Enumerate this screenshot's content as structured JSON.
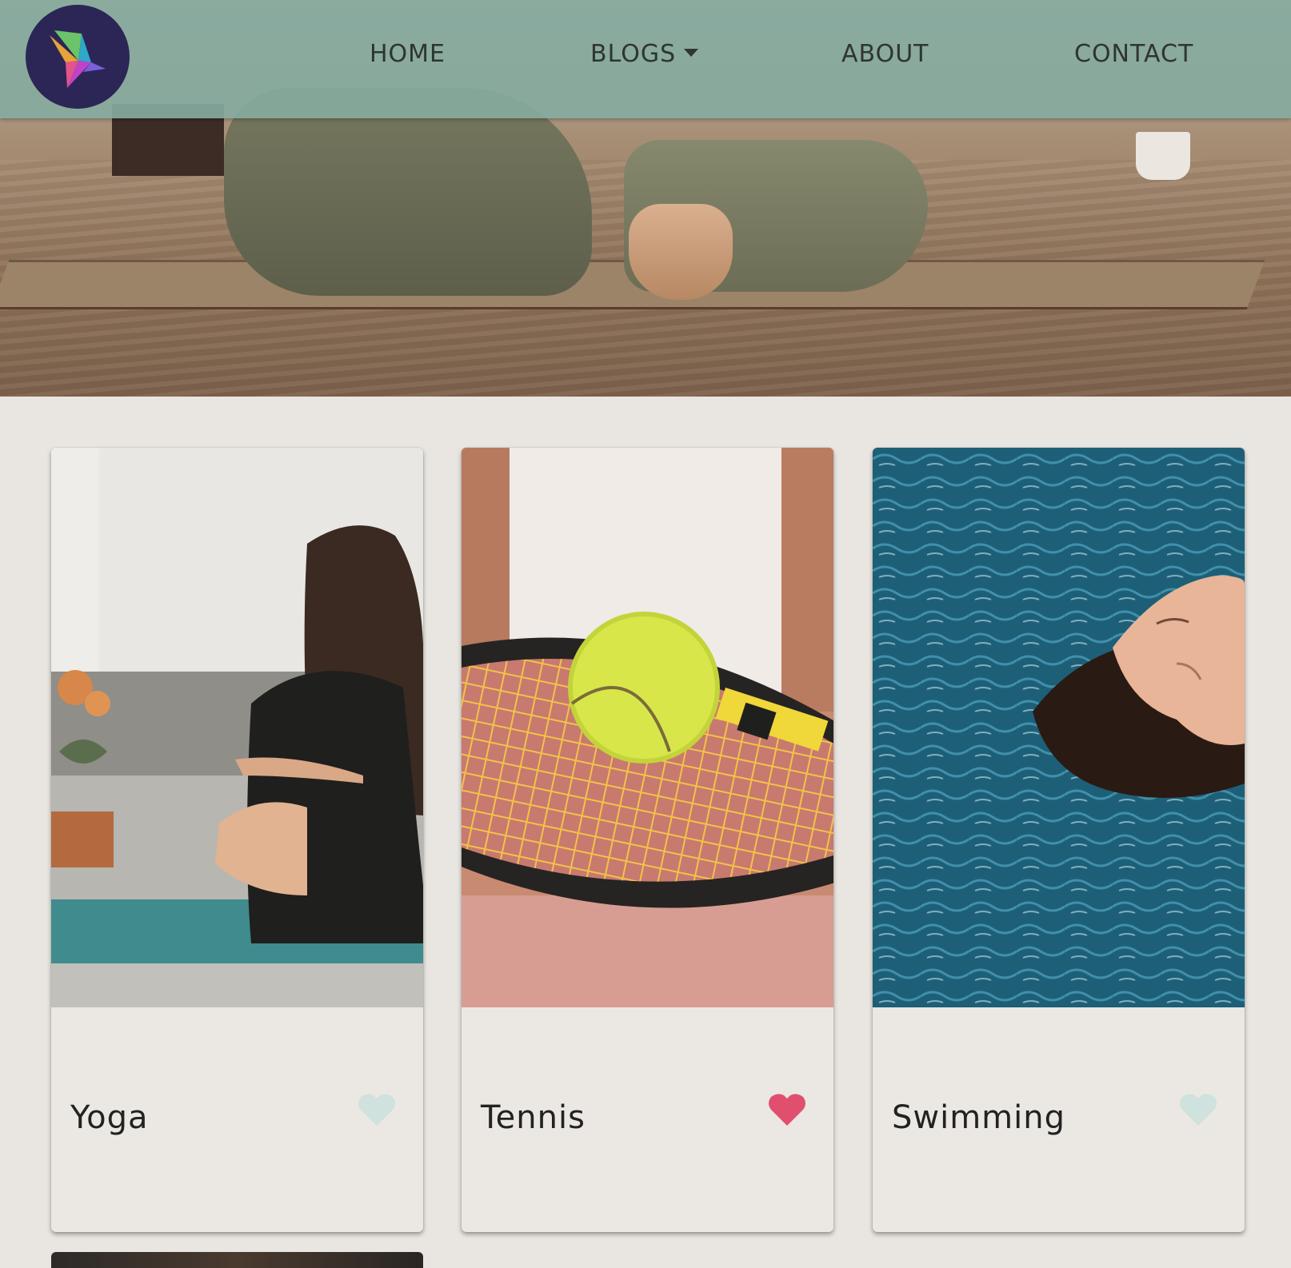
{
  "nav": {
    "logo_icon": "paper-crane-logo-icon",
    "items": [
      {
        "label": "HOME"
      },
      {
        "label": "BLOGS",
        "icon": "caret-down-icon"
      },
      {
        "label": "ABOUT"
      },
      {
        "label": "CONTACT"
      }
    ],
    "background": "#86aa9e"
  },
  "hero": {
    "description_icon": "yoga-hero-image"
  },
  "cards": [
    {
      "title": "Yoga",
      "liked": false,
      "heart_color": "#cfe2dd",
      "image": "yoga-card-image"
    },
    {
      "title": "Tennis",
      "liked": true,
      "heart_color": "#e0506e",
      "image": "tennis-card-image"
    },
    {
      "title": "Swimming",
      "liked": false,
      "heart_color": "#cfe2dd",
      "image": "swimming-card-image"
    }
  ],
  "colors": {
    "page_background": "#e9e6e1",
    "card_background": "#ebe8e3",
    "liked_heart": "#e0506e",
    "unliked_heart": "#cfe2dd"
  }
}
